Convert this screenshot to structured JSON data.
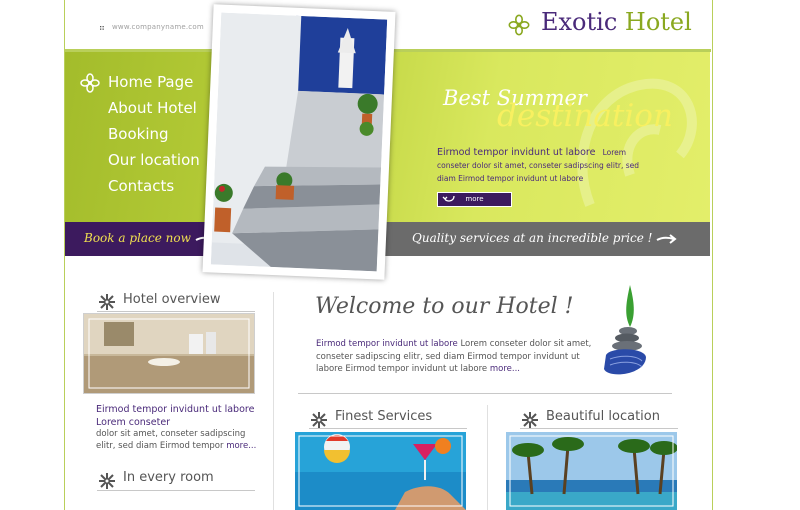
{
  "header": {
    "url_text": "www.companyname.com",
    "logo_word1": "Exotic",
    "logo_word2": "Hotel"
  },
  "nav": {
    "items": [
      {
        "label": "Home Page"
      },
      {
        "label": "About Hotel"
      },
      {
        "label": "Booking"
      },
      {
        "label": "Our location"
      },
      {
        "label": "Contacts"
      }
    ]
  },
  "banner": {
    "headline_line1": "Best Summer",
    "headline_line2": "destination",
    "lead": "Eirmod tempor invidunt ut labore",
    "body": "Lorem conseter dolor sit amet, conseter sadipscing elitr, sed diam Eirmod tempor invidunt ut labore",
    "more_label": "more"
  },
  "strip": {
    "book_label": "Book a place now",
    "tagline": "Quality services at an incredible price !"
  },
  "sections": {
    "hotel_overview": "Hotel overview",
    "in_every_room": "In every room",
    "finest_services": "Finest Services",
    "beautiful_location": "Beautiful location"
  },
  "welcome": {
    "title": "Welcome to our Hotel !",
    "lead": "Eirmod tempor invidunt ut labore",
    "body": " Lorem conseter dolor sit amet, conseter sadipscing elitr, sed diam Eirmod tempor invidunt ut labore Eirmod tempor invidunt ut labore ",
    "more_label": "more..."
  },
  "overview": {
    "lead": "Eirmod tempor invidunt ut labore Lorem conseter",
    "body": "dolor sit amet, conseter sadipscing elitr, sed diam Eirmod tempor ",
    "more_label": "more..."
  },
  "colors": {
    "accent_purple": "#4a2a7a",
    "accent_green": "#b9cf3a",
    "gray_strip": "#6b6b6b"
  }
}
